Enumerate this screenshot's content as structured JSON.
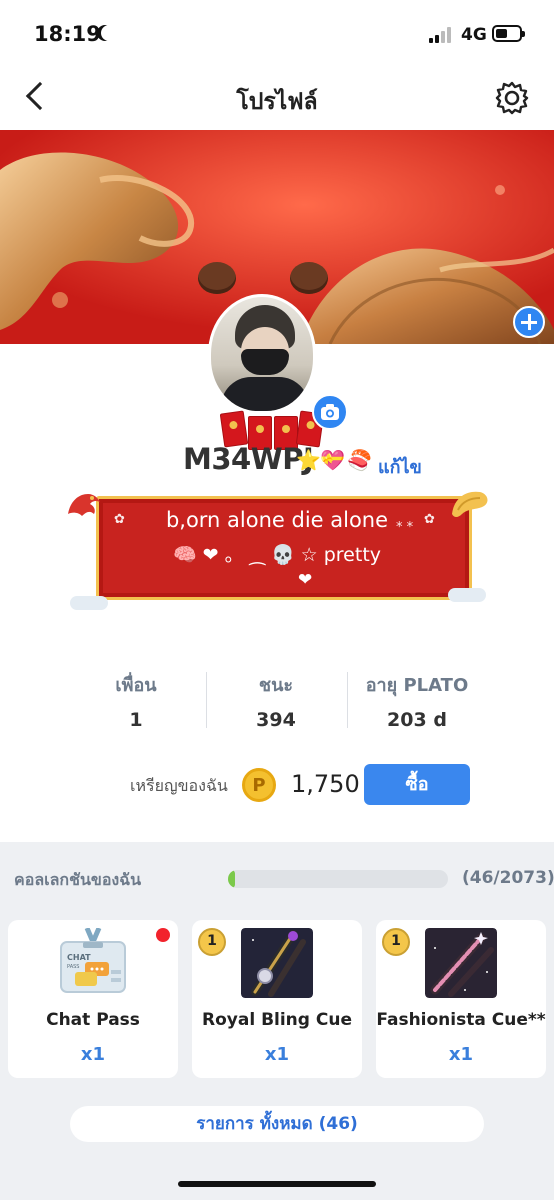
{
  "status_bar": {
    "time": "18:19",
    "network": "4G"
  },
  "nav": {
    "title": "โปรไฟล์"
  },
  "profile": {
    "username": "M34WPJ",
    "name_emojis": [
      "⭐",
      "💝",
      "🍣"
    ],
    "edit_label": "แก้ไข",
    "bio_line1": "b,orn alone die alone",
    "bio_line2": "🧠 ❤ 。 ⁔ 💀 ☆ pretty",
    "bio_line3": "❤"
  },
  "stats": [
    {
      "label": "เพื่อน",
      "value": "1"
    },
    {
      "label": "ชนะ",
      "value": "394"
    },
    {
      "label": "อายุ PLATO",
      "value": "203 d"
    }
  ],
  "coins": {
    "label": "เหรียญของฉัน",
    "symbol": "P",
    "amount": "1,750",
    "buy_label": "ซื้อ"
  },
  "collection": {
    "title": "คอลเลกชันของฉัน",
    "progress": 0.022,
    "count_text": "(46/2073)",
    "items": [
      {
        "name": "Chat Pass",
        "qty": "x1",
        "rank": "",
        "new": true,
        "art": "chat-pass-icon"
      },
      {
        "name": "Royal Bling Cue",
        "qty": "x1",
        "rank": "1",
        "new": false,
        "art": "royal-bling-cue-icon"
      },
      {
        "name": "Fashionista Cue**",
        "qty": "x1",
        "rank": "1",
        "new": false,
        "art": "fashionista-cue-icon"
      }
    ],
    "all_items_label": "รายการ ทั้งหมด (46)"
  },
  "colors": {
    "accent": "#3a87ee",
    "banner": "#d3241d",
    "progress": "#7bc94a"
  }
}
